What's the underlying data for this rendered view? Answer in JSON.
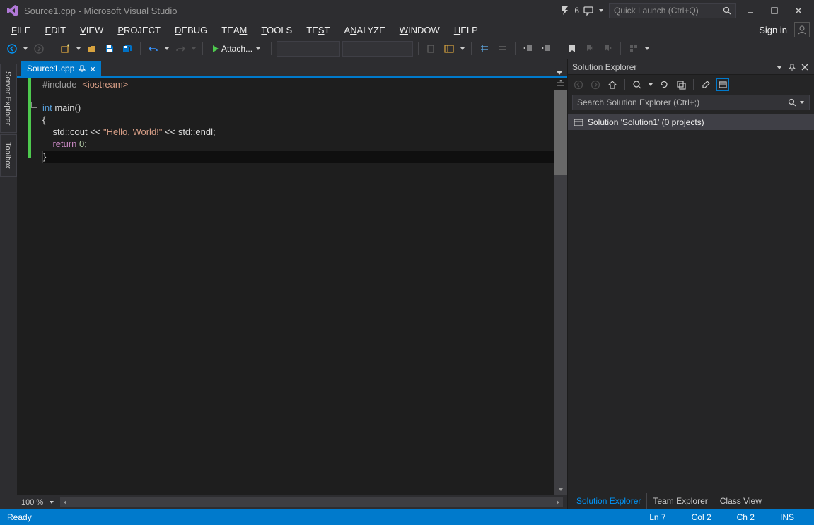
{
  "titlebar": {
    "title": "Source1.cpp - Microsoft Visual Studio",
    "notification_count": "6",
    "quick_launch_placeholder": "Quick Launch (Ctrl+Q)"
  },
  "menubar": {
    "items": [
      "FILE",
      "EDIT",
      "VIEW",
      "PROJECT",
      "DEBUG",
      "TEAM",
      "TOOLS",
      "TEST",
      "ANALYZE",
      "WINDOW",
      "HELP"
    ],
    "signin": "Sign in"
  },
  "toolbar": {
    "attach_label": "Attach..."
  },
  "sidetabs": {
    "items": [
      "Server Explorer",
      "Toolbox"
    ]
  },
  "doc_tab": {
    "label": "Source1.cpp"
  },
  "code": {
    "line1_a": "#include",
    "line1_b": "<iostream>",
    "line3_a": "int",
    "line3_b": " main()",
    "line4": "{",
    "line5_a": "    std::cout << ",
    "line5_b": "\"Hello, World!\"",
    "line5_c": " << std::endl;",
    "line6_a": "    ",
    "line6_b": "return",
    "line6_c": " ",
    "line6_d": "0",
    "line6_e": ";",
    "line7": "}"
  },
  "editor_status": {
    "zoom": "100 %"
  },
  "solution_explorer": {
    "title": "Solution Explorer",
    "search_placeholder": "Search Solution Explorer (Ctrl+;)",
    "tree_item": "Solution 'Solution1' (0 projects)",
    "bottom_tabs": [
      "Solution Explorer",
      "Team Explorer",
      "Class View"
    ]
  },
  "statusbar": {
    "ready": "Ready",
    "line": "Ln 7",
    "col": "Col 2",
    "ch": "Ch 2",
    "ins": "INS"
  }
}
